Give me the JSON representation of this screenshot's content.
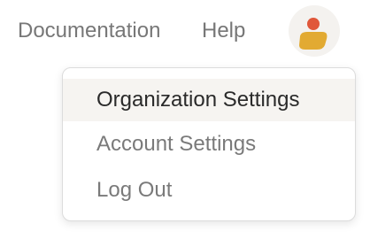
{
  "nav": {
    "documentation_label": "Documentation",
    "help_label": "Help"
  },
  "avatar": {
    "icon": "person-icon",
    "head_color": "#e0573a",
    "body_color": "#e2aa32"
  },
  "menu": {
    "items": [
      {
        "label": "Organization Settings",
        "highlighted": true
      },
      {
        "label": "Account Settings",
        "highlighted": false
      },
      {
        "label": "Log Out",
        "highlighted": false
      }
    ]
  }
}
